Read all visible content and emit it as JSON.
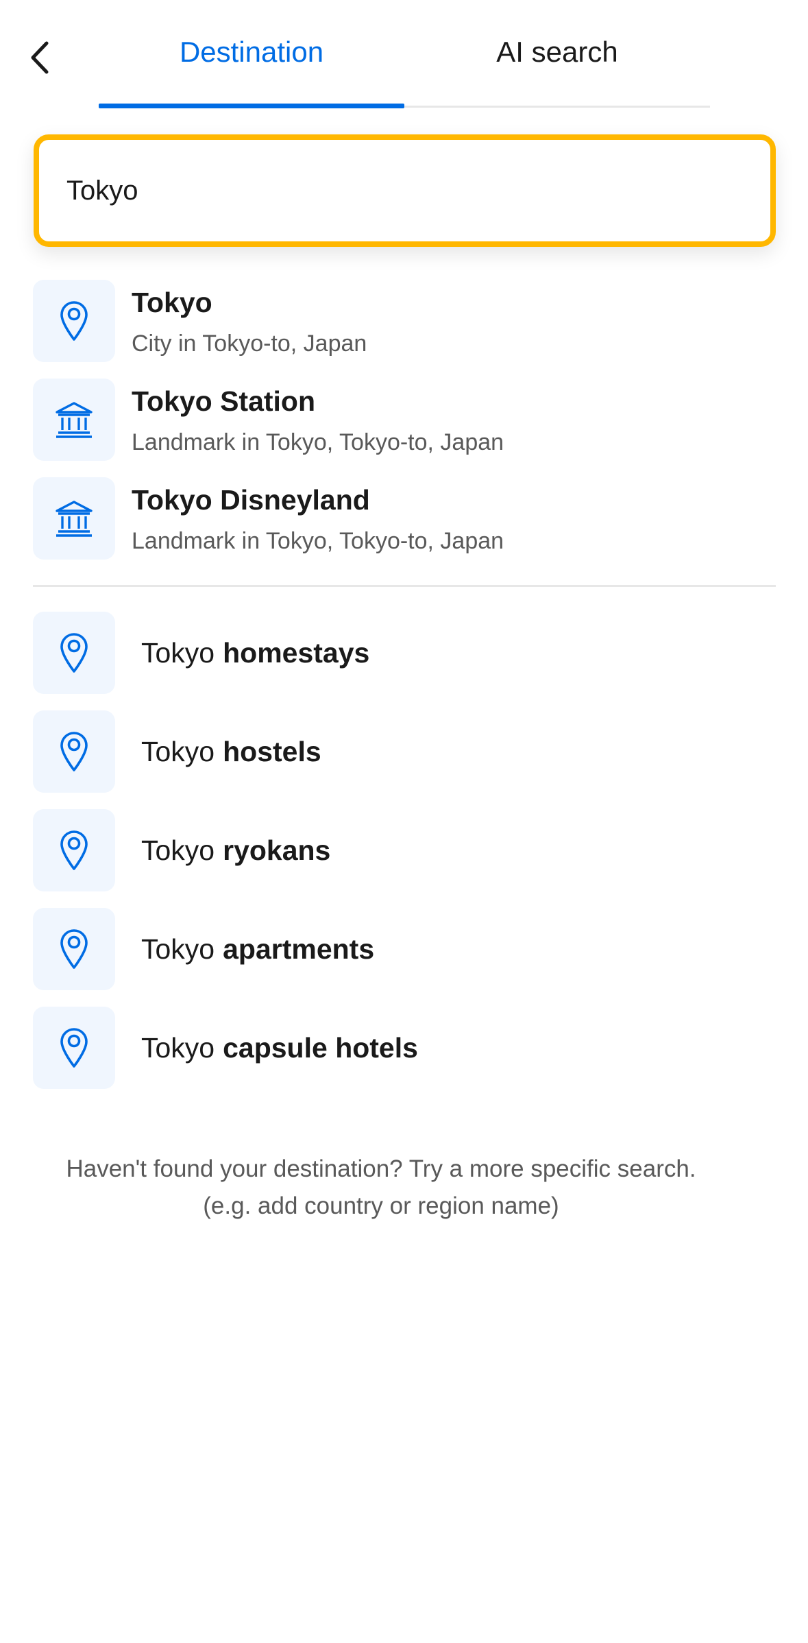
{
  "tabs": [
    {
      "label": "Destination",
      "active": true
    },
    {
      "label": "AI search",
      "active": false
    }
  ],
  "search": {
    "value": "Tokyo",
    "focus_color": "#ffb700"
  },
  "results": [
    {
      "title": "Tokyo",
      "subtitle": "City in Tokyo-to, Japan",
      "icon": "location-pin-icon"
    },
    {
      "title": "Tokyo Station",
      "subtitle": "Landmark in Tokyo, Tokyo-to, Japan",
      "icon": "landmark-icon"
    },
    {
      "title": "Tokyo Disneyland",
      "subtitle": "Landmark in Tokyo, Tokyo-to, Japan",
      "icon": "landmark-icon"
    }
  ],
  "suggestions": [
    {
      "prefix": "Tokyo",
      "bold": "homestays",
      "icon": "location-pin-icon"
    },
    {
      "prefix": "Tokyo",
      "bold": "hostels",
      "icon": "location-pin-icon"
    },
    {
      "prefix": "Tokyo",
      "bold": "ryokans",
      "icon": "location-pin-icon"
    },
    {
      "prefix": "Tokyo",
      "bold": "apartments",
      "icon": "location-pin-icon"
    },
    {
      "prefix": "Tokyo",
      "bold": "capsule hotels",
      "icon": "location-pin-icon"
    }
  ],
  "footer": {
    "line1": "Haven't found your destination? Try a more specific search.",
    "line2": "(e.g. add country or region name)"
  },
  "colors": {
    "accent": "#006ce4",
    "icon_bg": "#f0f6fe",
    "focus": "#ffb700"
  }
}
